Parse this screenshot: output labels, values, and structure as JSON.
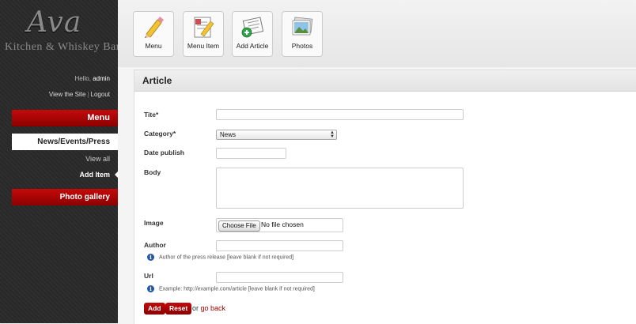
{
  "brand": {
    "name": "Ava",
    "tagline": "Kitchen & Whiskey Bar"
  },
  "user": {
    "hello_prefix": "Hello,",
    "username": "admin",
    "view_site": "View the Site",
    "separator": "|",
    "logout": "Logout"
  },
  "sidebar": {
    "menu": "Menu",
    "section": "News/Events/Press",
    "sub_items": [
      "View all",
      "Add Item"
    ],
    "gallery": "Photo gallery"
  },
  "toolbar": {
    "items": [
      "Menu",
      "Menu Item",
      "Add Article",
      "Photos"
    ]
  },
  "form": {
    "title": "Article",
    "labels": {
      "title": "Tite*",
      "category": "Category*",
      "date": "Date publish",
      "body": "Body",
      "image": "Image",
      "author": "Author",
      "url": "Url"
    },
    "category_value": "News",
    "file_button": "Choose File",
    "file_status": "No file chosen",
    "author_hint": "Author of the press release [leave blank if not required]",
    "url_hint": "Example: http://example.com/article [leave blank if not required]",
    "add": "Add",
    "reset": "Reset",
    "or_text": "or",
    "go_back": "go back"
  },
  "colors": {
    "accent": "#a30000",
    "sidebar_bg": "#2a2a2a"
  }
}
